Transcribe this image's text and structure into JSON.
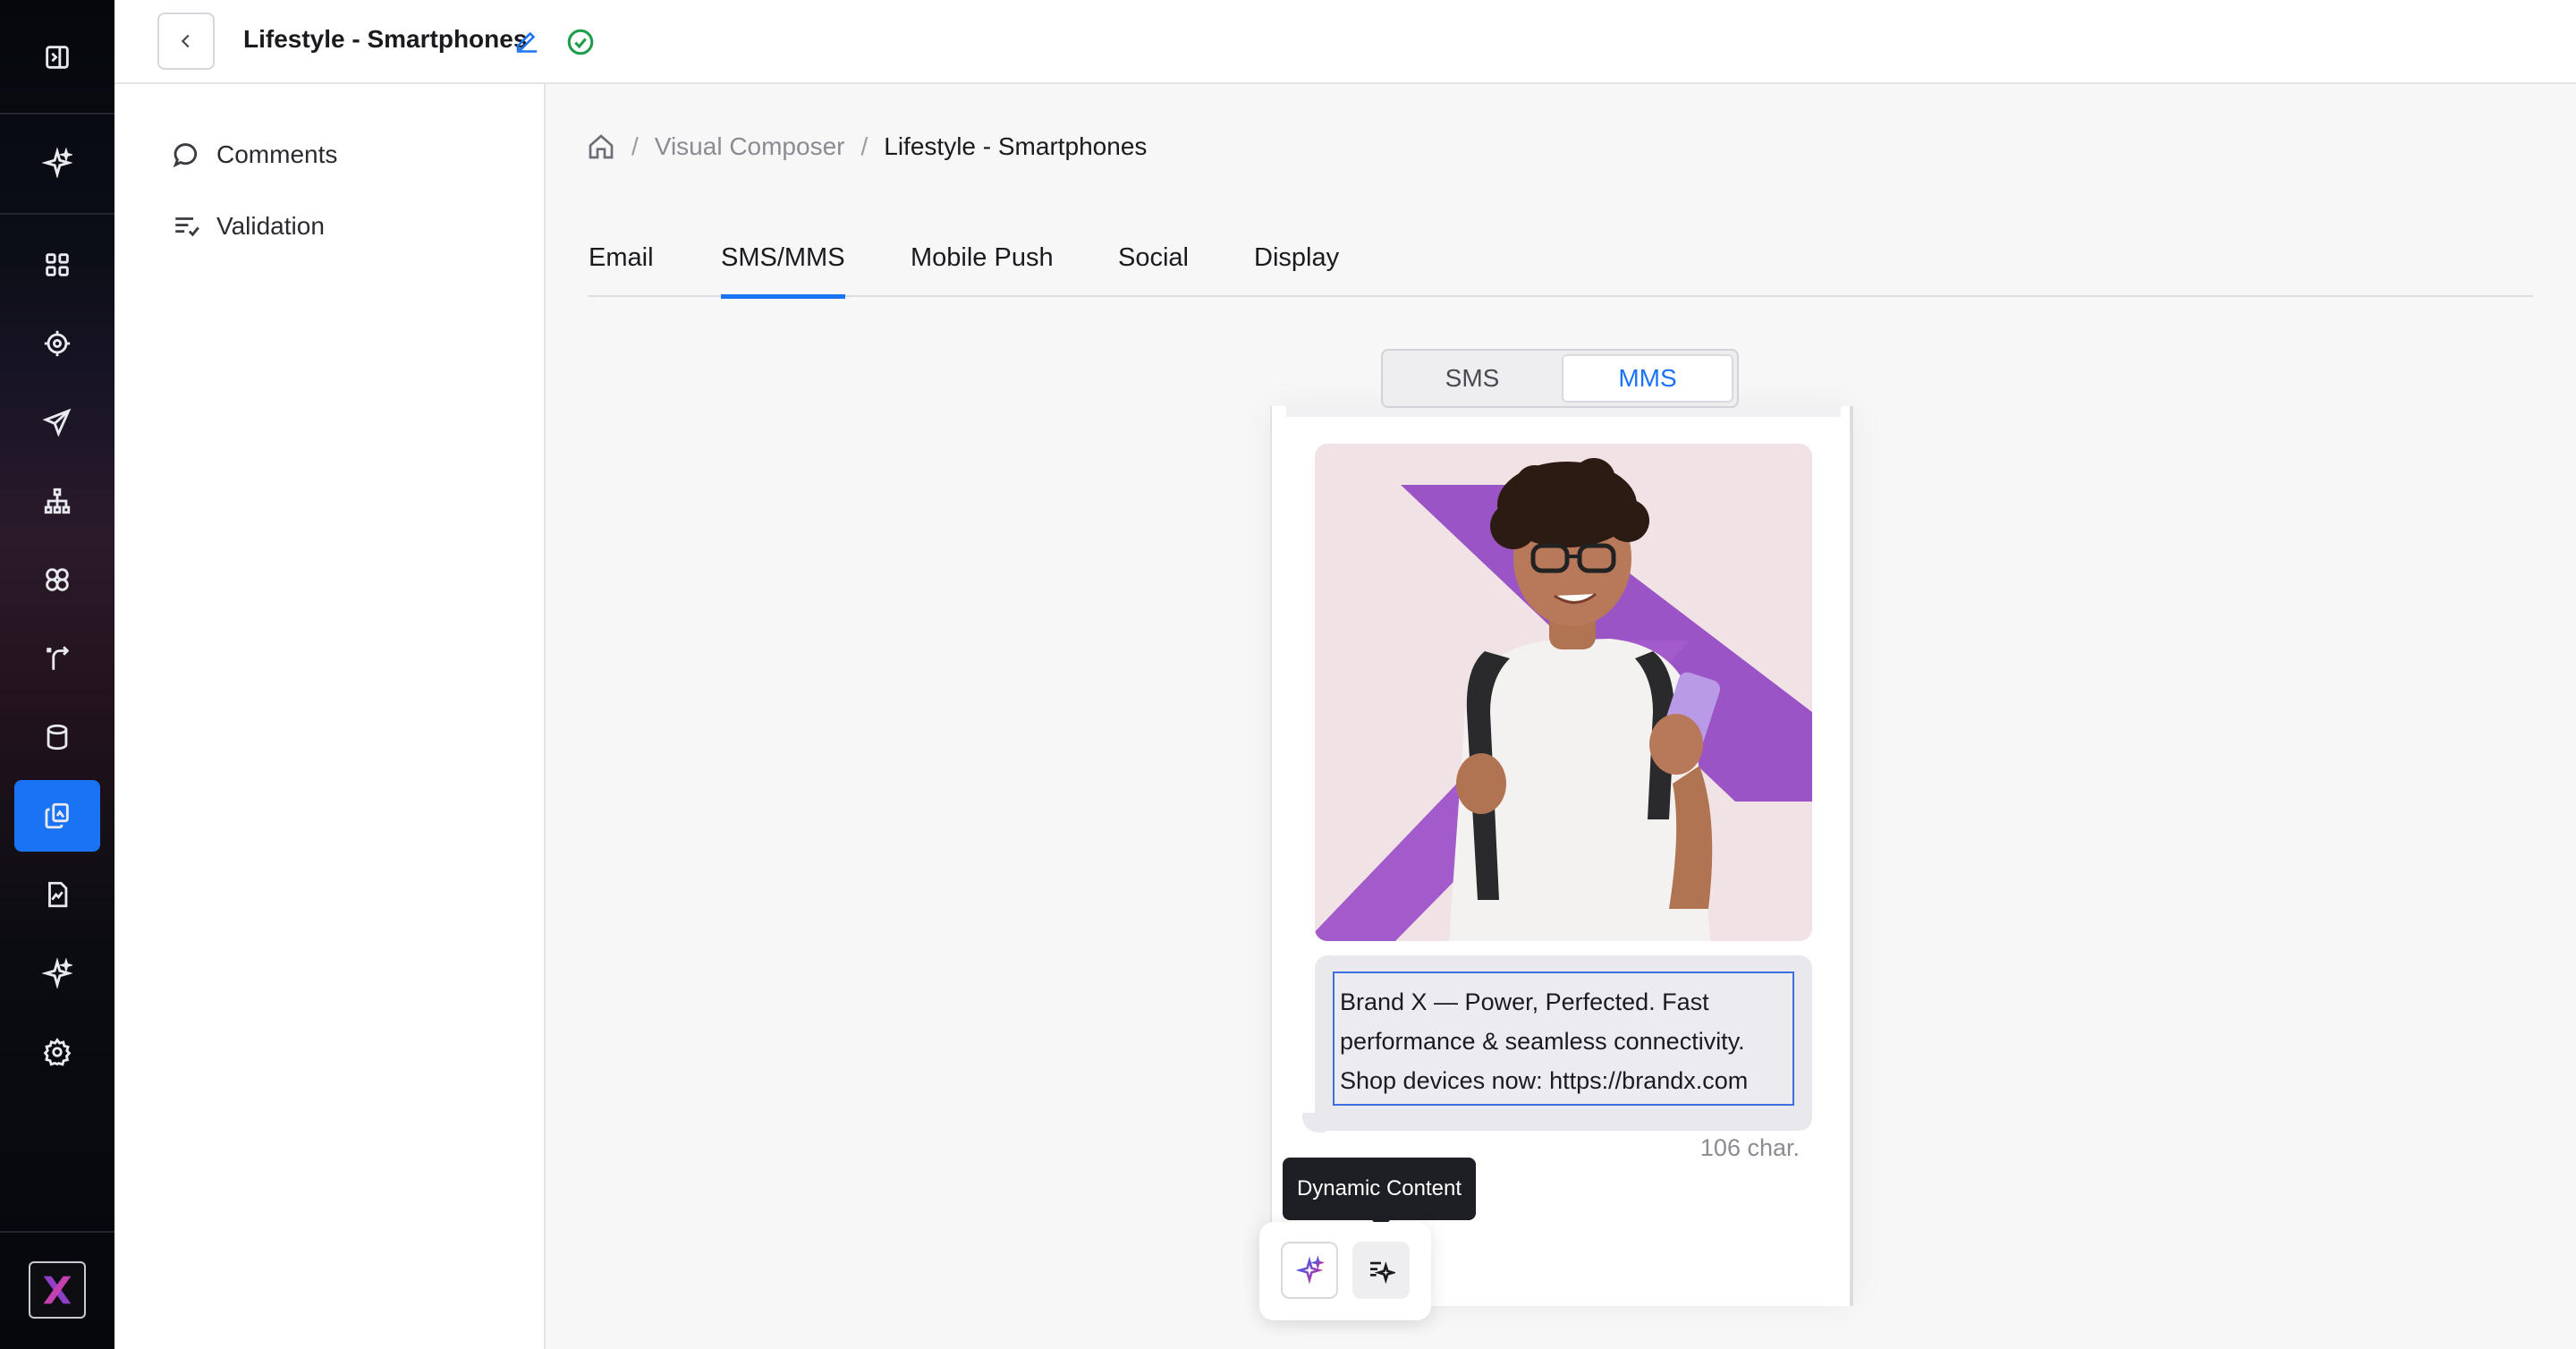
{
  "header": {
    "title": "Lifestyle - Smartphones",
    "back_icon": "chevron-left-icon",
    "edit_icon": "pencil-icon",
    "status_icon": "check-circle-icon",
    "status_color": "#1e9e4a"
  },
  "rail": {
    "icons": [
      "panel-toggle-icon",
      "sparkle-icon",
      "dashboard-icon",
      "target-icon",
      "send-icon",
      "hierarchy-icon",
      "segments-icon",
      "journey-icon",
      "database-icon",
      "content-icon",
      "report-icon",
      "ai-sparkle-icon",
      "settings-icon"
    ],
    "active": "content-icon",
    "accent": "#1a73f5"
  },
  "sidepanel": {
    "items": [
      {
        "label": "Comments",
        "icon": "comment-icon"
      },
      {
        "label": "Validation",
        "icon": "checklist-icon"
      }
    ]
  },
  "breadcrumb": {
    "home_icon": "home-icon",
    "separator": "/",
    "parent": "Visual Composer",
    "current": "Lifestyle - Smartphones"
  },
  "tabs": {
    "items": [
      "Email",
      "SMS/MMS",
      "Mobile Push",
      "Social",
      "Display"
    ],
    "active": "SMS/MMS"
  },
  "mode_toggle": {
    "sms": "SMS",
    "mms": "MMS",
    "active": "MMS"
  },
  "preview": {
    "message": "Brand X — Power, Perfected. Fast performance & seamless connectivity. Shop devices now: https://brandx.com",
    "char_count": "106 char."
  },
  "toolbar": {
    "tooltip": "Dynamic Content",
    "ai_icon": "ai-sparkle-icon",
    "dynamic_icon": "dynamic-content-icon"
  }
}
